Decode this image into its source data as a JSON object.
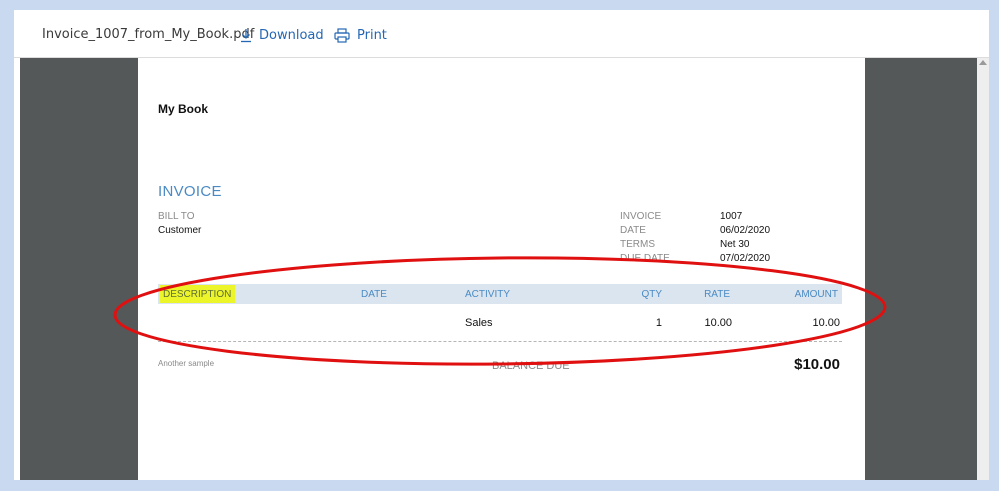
{
  "toolbar": {
    "filename": "Invoice_1007_from_My_Book.pdf",
    "download_label": "Download",
    "print_label": "Print"
  },
  "invoice": {
    "company": "My Book",
    "title": "INVOICE",
    "bill_to_label": "BILL TO",
    "bill_to_value": "Customer",
    "meta": [
      {
        "label": "INVOICE",
        "value": "1007"
      },
      {
        "label": "DATE",
        "value": "06/02/2020"
      },
      {
        "label": "TERMS",
        "value": "Net 30"
      },
      {
        "label": "DUE DATE",
        "value": "07/02/2020"
      }
    ],
    "columns": {
      "description": "DESCRIPTION",
      "date": "DATE",
      "activity": "ACTIVITY",
      "qty": "QTY",
      "rate": "RATE",
      "amount": "AMOUNT"
    },
    "rows": [
      {
        "activity": "Sales",
        "qty": "1",
        "rate": "10.00",
        "amount": "10.00"
      }
    ],
    "note": "Another sample",
    "balance_due_label": "BALANCE DUE",
    "balance_due_amount": "$10.00"
  },
  "colors": {
    "accent_blue": "#4a8ac4",
    "link_blue": "#2467b3",
    "highlight": "#ecf52a",
    "annotation_red": "#e01010",
    "viewer_bg": "#555859"
  },
  "icons": [
    "download-icon",
    "print-icon"
  ]
}
